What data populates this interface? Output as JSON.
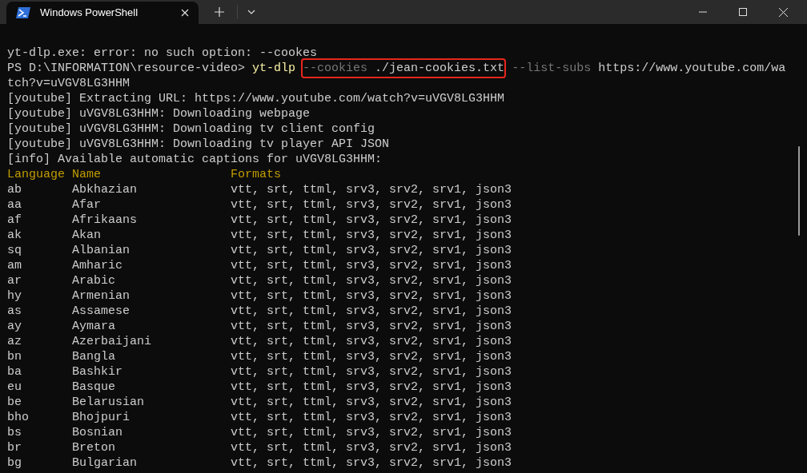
{
  "window": {
    "tab": {
      "title": "Windows PowerShell",
      "selected": true
    }
  },
  "output_before": [
    "yt-dlp.exe: error: no such option: --cookes"
  ],
  "prompt_line": {
    "segments": [
      {
        "kind": "plain",
        "text": "PS D:\\INFORMATION\\resource-video> "
      },
      {
        "kind": "command",
        "text": "yt-dlp"
      },
      {
        "kind": "space"
      },
      {
        "kind": "boxed",
        "segments": [
          {
            "kind": "parameter",
            "text": "--cookies"
          },
          {
            "kind": "plain",
            "text": " ./jean-cookies.txt"
          }
        ]
      },
      {
        "kind": "space"
      },
      {
        "kind": "parameter",
        "text": "--list-subs"
      },
      {
        "kind": "plain",
        "text": " https://www.youtube.com/wa"
      }
    ]
  },
  "output": [
    "tch?v=uVGV8LG3HHM",
    "[youtube] Extracting URL: https://www.youtube.com/watch?v=uVGV8LG3HHM",
    "[youtube] uVGV8LG3HHM: Downloading webpage",
    "[youtube] uVGV8LG3HHM: Downloading tv client config",
    "[youtube] uVGV8LG3HHM: Downloading tv player API JSON",
    "[info] Available automatic captions for uVGV8LG3HHM:"
  ],
  "captions_table": {
    "columns": [
      "Language",
      "Name",
      "Formats"
    ],
    "rows": [
      {
        "language": "ab",
        "name": "Abkhazian",
        "formats": "vtt, srt, ttml, srv3, srv2, srv1, json3"
      },
      {
        "language": "aa",
        "name": "Afar",
        "formats": "vtt, srt, ttml, srv3, srv2, srv1, json3"
      },
      {
        "language": "af",
        "name": "Afrikaans",
        "formats": "vtt, srt, ttml, srv3, srv2, srv1, json3"
      },
      {
        "language": "ak",
        "name": "Akan",
        "formats": "vtt, srt, ttml, srv3, srv2, srv1, json3"
      },
      {
        "language": "sq",
        "name": "Albanian",
        "formats": "vtt, srt, ttml, srv3, srv2, srv1, json3"
      },
      {
        "language": "am",
        "name": "Amharic",
        "formats": "vtt, srt, ttml, srv3, srv2, srv1, json3"
      },
      {
        "language": "ar",
        "name": "Arabic",
        "formats": "vtt, srt, ttml, srv3, srv2, srv1, json3"
      },
      {
        "language": "hy",
        "name": "Armenian",
        "formats": "vtt, srt, ttml, srv3, srv2, srv1, json3"
      },
      {
        "language": "as",
        "name": "Assamese",
        "formats": "vtt, srt, ttml, srv3, srv2, srv1, json3"
      },
      {
        "language": "ay",
        "name": "Aymara",
        "formats": "vtt, srt, ttml, srv3, srv2, srv1, json3"
      },
      {
        "language": "az",
        "name": "Azerbaijani",
        "formats": "vtt, srt, ttml, srv3, srv2, srv1, json3"
      },
      {
        "language": "bn",
        "name": "Bangla",
        "formats": "vtt, srt, ttml, srv3, srv2, srv1, json3"
      },
      {
        "language": "ba",
        "name": "Bashkir",
        "formats": "vtt, srt, ttml, srv3, srv2, srv1, json3"
      },
      {
        "language": "eu",
        "name": "Basque",
        "formats": "vtt, srt, ttml, srv3, srv2, srv1, json3"
      },
      {
        "language": "be",
        "name": "Belarusian",
        "formats": "vtt, srt, ttml, srv3, srv2, srv1, json3"
      },
      {
        "language": "bho",
        "name": "Bhojpuri",
        "formats": "vtt, srt, ttml, srv3, srv2, srv1, json3"
      },
      {
        "language": "bs",
        "name": "Bosnian",
        "formats": "vtt, srt, ttml, srv3, srv2, srv1, json3"
      },
      {
        "language": "br",
        "name": "Breton",
        "formats": "vtt, srt, ttml, srv3, srv2, srv1, json3"
      },
      {
        "language": "bg",
        "name": "Bulgarian",
        "formats": "vtt, srt, ttml, srv3, srv2, srv1, json3"
      }
    ]
  }
}
